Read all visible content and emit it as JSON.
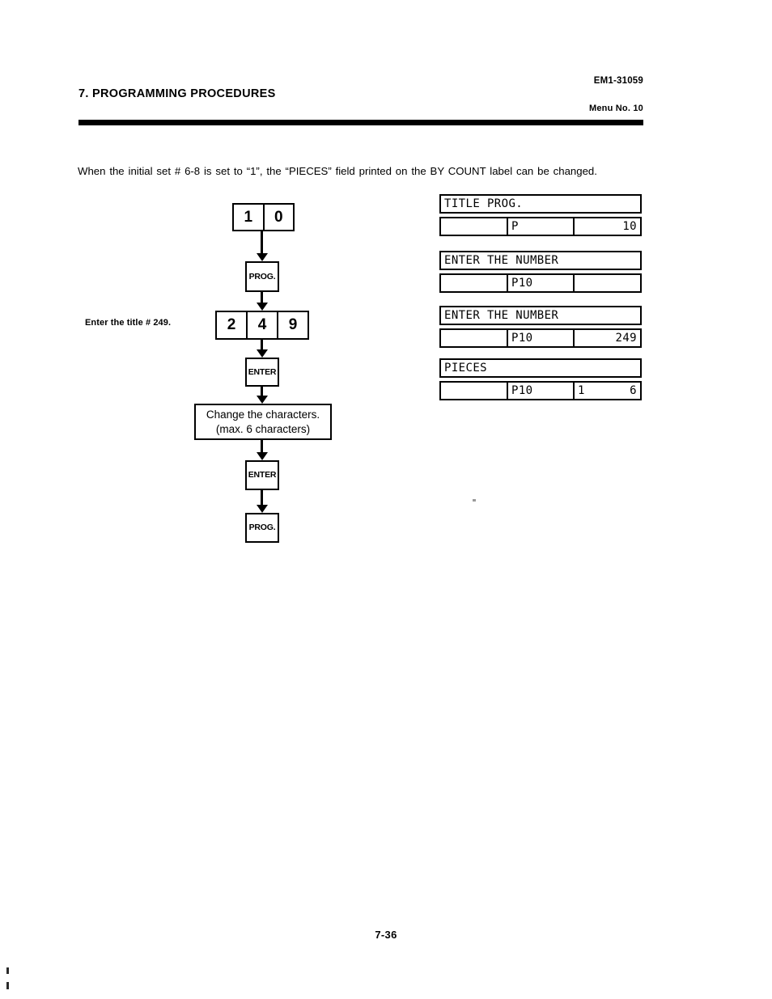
{
  "header": {
    "chapter_title": "7. PROGRAMMING PROCEDURES",
    "doc_code": "EM1-31059",
    "menu_no": "Menu No. 10"
  },
  "intro": {
    "paragraph": "When the initial set # 6-8 is set to “1”, the “PIECES” field printed on the BY COUNT label can be changed."
  },
  "flowchart": {
    "annotation_enter_title": "Enter the title # 249.",
    "keys_10": [
      "1",
      "0"
    ],
    "prog_key_1": "PROG.",
    "keys_249": [
      "2",
      "4",
      "9"
    ],
    "enter_key_1": "ENTER",
    "change_box": {
      "line1": "Change the characters.",
      "line2": "(max. 6 characters)"
    },
    "enter_key_2": "ENTER",
    "prog_key_2": "PROG."
  },
  "displays": [
    {
      "title": "TITLE PROG.",
      "cells": [
        "",
        "P",
        "10"
      ],
      "cell3_left": "",
      "cell3_right": "10"
    },
    {
      "title": "ENTER THE NUMBER",
      "cells": [
        "",
        "P10",
        ""
      ],
      "cell3_left": "",
      "cell3_right": ""
    },
    {
      "title": "ENTER THE NUMBER",
      "cells": [
        "",
        "P10",
        "249"
      ],
      "cell3_left": "",
      "cell3_right": "249"
    },
    {
      "title": "PIECES",
      "cells": [
        "",
        "P10",
        "1      6"
      ],
      "cell3_left": "1",
      "cell3_right": "6"
    }
  ],
  "footer": {
    "page_number": "7-36"
  }
}
